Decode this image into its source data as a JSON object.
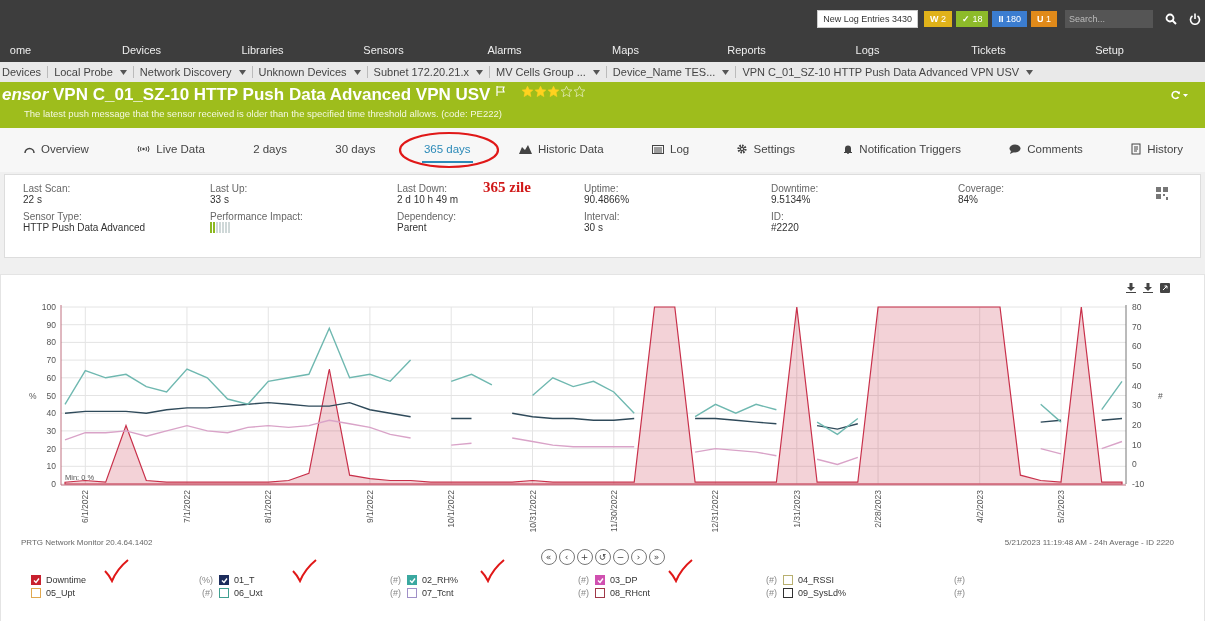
{
  "topbar": {
    "log_label": "New Log Entries",
    "log_count": "3430",
    "badges": [
      {
        "symbol": "W",
        "count": "2",
        "color": "#e0b21a"
      },
      {
        "symbol": "✓",
        "count": "18",
        "color": "#8dbb2a"
      },
      {
        "symbol": "II",
        "count": "180",
        "color": "#3b7dd0"
      },
      {
        "symbol": "U",
        "count": "1",
        "color": "#e08a1a"
      }
    ],
    "search": {
      "placeholder": "Search..."
    }
  },
  "nav": [
    "ome",
    "Devices",
    "Libraries",
    "Sensors",
    "Alarms",
    "Maps",
    "Reports",
    "Logs",
    "Tickets",
    "Setup"
  ],
  "breadcrumbs": [
    {
      "label": "Devices",
      "has_menu": false
    },
    {
      "label": "Local Probe",
      "has_menu": true
    },
    {
      "label": "Network Discovery",
      "has_menu": true
    },
    {
      "label": "Unknown Devices",
      "has_menu": true
    },
    {
      "label": "Subnet 172.20.21.x",
      "has_menu": true
    },
    {
      "label": "MV Cells Group ...",
      "has_menu": true
    },
    {
      "label": "Device_Name TES...",
      "has_menu": true
    },
    {
      "label": "VPN C_01_SZ-10 HTTP Push Data Advanced VPN USV",
      "has_menu": true
    }
  ],
  "sensor": {
    "title": "*ensor* VPN C_01_SZ-10 HTTP Push Data Advanced VPN USV",
    "stars": 3,
    "message": "The latest push message that the sensor received is older than the specified time threshold allows. (code: PE222)"
  },
  "tabs": [
    {
      "label": "Overview",
      "selected": false,
      "circled": false
    },
    {
      "label": "Live Data",
      "selected": false,
      "circled": false
    },
    {
      "label": "2  days",
      "selected": false,
      "circled": false
    },
    {
      "label": "30 days",
      "selected": false,
      "circled": false
    },
    {
      "label": "365 days",
      "selected": true,
      "circled": true
    },
    {
      "label": "Historic Data",
      "selected": false,
      "circled": false
    },
    {
      "label": "Log",
      "selected": false,
      "circled": false
    },
    {
      "label": "Settings",
      "selected": false,
      "circled": false
    },
    {
      "label": "Notification Triggers",
      "selected": false,
      "circled": false
    },
    {
      "label": "Comments",
      "selected": false,
      "circled": false
    },
    {
      "label": "History",
      "selected": false,
      "circled": false
    }
  ],
  "handwritten_note": "365 zile",
  "info": [
    {
      "label": "Last Scan:",
      "value": "22 s"
    },
    {
      "label": "Last Up:",
      "value": "33 s"
    },
    {
      "label": "Last Down:",
      "value": "2 d 10 h 49 m"
    },
    {
      "label": "Uptime:",
      "value": "90.4866%"
    },
    {
      "label": "Downtime:",
      "value": "9.5134%"
    },
    {
      "label": "Coverage:",
      "value": "84%"
    },
    {
      "label": "Sensor Type:",
      "value": "HTTP Push Data Advanced"
    },
    {
      "label": "Performance Impact:",
      "kind": "meter"
    },
    {
      "label": "Dependency:",
      "value": "Parent"
    },
    {
      "label": "Interval:",
      "value": "30 s"
    },
    {
      "label": "ID:",
      "value": "#2220"
    }
  ],
  "chart": {
    "chart_data": {
      "type": "line",
      "grid": true,
      "ylabel": "%",
      "ylim": [
        0,
        100
      ],
      "yticks": [
        100,
        90,
        80,
        70,
        60,
        50,
        40,
        30,
        20,
        10,
        0
      ],
      "categories": [
        null,
        "6/1/2022",
        null,
        null,
        null,
        null,
        "7/1/2022",
        null,
        null,
        null,
        "8/1/2022",
        null,
        null,
        null,
        null,
        "9/1/2022",
        null,
        null,
        null,
        "10/1/2022",
        null,
        null,
        null,
        "10/31/2022",
        null,
        null,
        null,
        "11/30/2022",
        null,
        null,
        null,
        null,
        "12/31/2022",
        null,
        null,
        null,
        "1/31/2023",
        null,
        null,
        null,
        "2/28/2023",
        null,
        null,
        null,
        null,
        "4/2/2023",
        null,
        null,
        null,
        "5/2/2023",
        null,
        null,
        null
      ],
      "series": [
        {
          "type": "area",
          "color": "#c8304a",
          "values": [
            1,
            2,
            1,
            33,
            2,
            1,
            1,
            1,
            1,
            1,
            1,
            2,
            6,
            65,
            5,
            3,
            2,
            2,
            1,
            1,
            1,
            1,
            1,
            2,
            1,
            1,
            1,
            1,
            1,
            100,
            100,
            1,
            1,
            1,
            1,
            1,
            100,
            1,
            1,
            1,
            100,
            100,
            100,
            100,
            100,
            100,
            100,
            5,
            2,
            1,
            100,
            1,
            1
          ]
        },
        {
          "type": "line",
          "color": "#2f4a5a",
          "values": [
            40,
            41,
            41,
            41,
            40,
            42,
            43,
            43,
            44,
            45,
            46,
            45,
            44,
            44,
            46,
            42,
            40,
            38,
            null,
            37,
            37,
            null,
            40,
            38,
            37,
            37,
            36,
            36,
            37,
            null,
            null,
            37,
            37,
            36,
            35,
            34,
            null,
            33,
            31,
            34,
            null,
            null,
            null,
            null,
            null,
            null,
            null,
            null,
            35,
            36,
            null,
            36,
            37
          ]
        },
        {
          "type": "line",
          "color": "#6fb8b0",
          "values": [
            45,
            64,
            60,
            62,
            55,
            52,
            65,
            60,
            48,
            45,
            58,
            60,
            62,
            88,
            60,
            62,
            58,
            70,
            null,
            58,
            62,
            56,
            null,
            50,
            60,
            55,
            58,
            52,
            40,
            null,
            null,
            38,
            45,
            40,
            45,
            42,
            null,
            35,
            28,
            37,
            null,
            null,
            null,
            null,
            null,
            null,
            null,
            null,
            45,
            35,
            null,
            42,
            58
          ]
        },
        {
          "type": "line",
          "color": "#d9a3c8",
          "values": [
            25,
            29,
            29,
            30,
            27,
            30,
            33,
            30,
            29,
            32,
            33,
            32,
            33,
            36,
            34,
            32,
            28,
            26,
            null,
            22,
            23,
            null,
            26,
            24,
            22,
            21,
            21,
            21,
            21,
            null,
            null,
            18,
            20,
            19,
            18,
            16,
            null,
            14,
            11,
            15,
            null,
            null,
            null,
            null,
            null,
            null,
            null,
            null,
            20,
            17,
            null,
            20,
            24
          ]
        }
      ],
      "annotations": [
        "Min: 0 %"
      ]
    },
    "right_axis": {
      "label": "#",
      "ticks": [
        "80",
        "70",
        "60",
        "50",
        "40",
        "30",
        "20",
        "10",
        "0",
        "-10"
      ]
    },
    "footer_left": "PRTG Network Monitor 20.4.64.1402",
    "footer_right": "5/21/2023 11:19:48 AM - 24h Average - ID 2220",
    "zoom_buttons": [
      "«",
      "‹",
      "+",
      "↺",
      "−",
      "›",
      "»"
    ]
  },
  "legend": [
    {
      "label": "Downtime",
      "unit": "(%)",
      "checked": true,
      "color": "#c8202e",
      "hand_ticked": true
    },
    {
      "label": "01_T",
      "unit": "(#)",
      "checked": true,
      "color": "#1c2c5c",
      "hand_ticked": true
    },
    {
      "label": "02_RH%",
      "unit": "(#)",
      "checked": true,
      "color": "#3aa8a0",
      "hand_ticked": true
    },
    {
      "label": "03_DP",
      "unit": "(#)",
      "checked": true,
      "color": "#d050b0",
      "hand_ticked": true
    },
    {
      "label": "04_RSSI",
      "unit": "(#)",
      "checked": false,
      "color": "#b8b070",
      "hand_ticked": false
    },
    {
      "label": "05_Upt",
      "unit": "(#)",
      "checked": false,
      "color": "#e0a850",
      "hand_ticked": false
    },
    {
      "label": "06_Uxt",
      "unit": "(#)",
      "checked": false,
      "color": "#40a090",
      "hand_ticked": false
    },
    {
      "label": "07_Tcnt",
      "unit": "(#)",
      "checked": false,
      "color": "#a090c8",
      "hand_ticked": false
    },
    {
      "label": "08_RHcnt",
      "unit": "(#)",
      "checked": false,
      "color": "#a03848",
      "hand_ticked": false
    },
    {
      "label": "09_SysLd%",
      "unit": "(#)",
      "checked": false,
      "color": "#303030",
      "hand_ticked": false
    }
  ]
}
